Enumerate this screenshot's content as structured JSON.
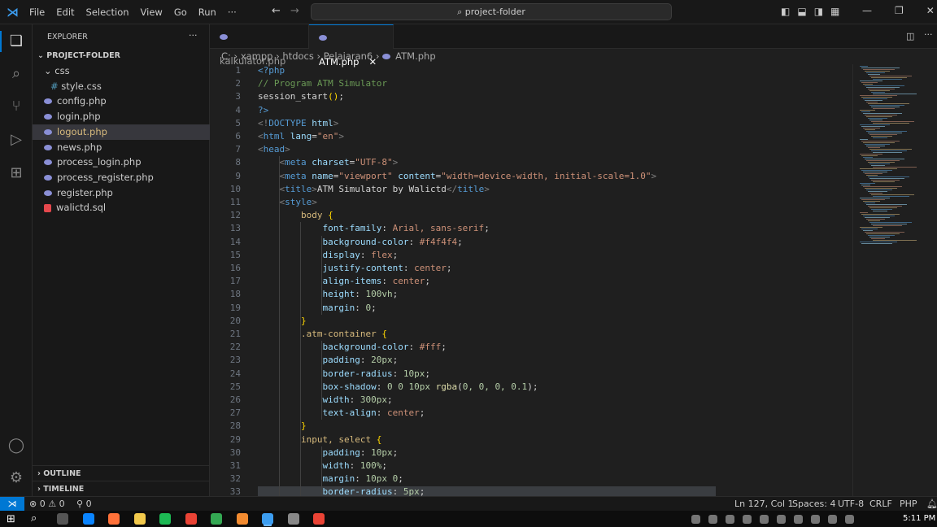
{
  "menu": [
    "File",
    "Edit",
    "Selection",
    "View",
    "Go",
    "Run",
    "···"
  ],
  "search": "project-folder",
  "explorer": {
    "title": "EXPLORER",
    "more": "···",
    "folder": "PROJECT-FOLDER",
    "items": [
      {
        "label": "css",
        "type": "folder",
        "depth": 1
      },
      {
        "label": "style.css",
        "type": "css",
        "depth": 2
      },
      {
        "label": "config.php",
        "type": "php",
        "depth": 1
      },
      {
        "label": "login.php",
        "type": "php",
        "depth": 1
      },
      {
        "label": "logout.php",
        "type": "php",
        "depth": 1,
        "selected": true
      },
      {
        "label": "news.php",
        "type": "php",
        "depth": 1
      },
      {
        "label": "process_login.php",
        "type": "php",
        "depth": 1
      },
      {
        "label": "process_register.php",
        "type": "php",
        "depth": 1
      },
      {
        "label": "register.php",
        "type": "php",
        "depth": 1
      },
      {
        "label": "walictd.sql",
        "type": "sql",
        "depth": 1
      }
    ],
    "outline": "OUTLINE",
    "timeline": "TIMELINE"
  },
  "tabs": [
    {
      "label": "kalkulator.php",
      "active": false
    },
    {
      "label": "ATM.php",
      "active": true
    }
  ],
  "breadcrumb": [
    "C:",
    "xampp",
    "htdocs",
    "Pelajaran6",
    "ATM.php"
  ],
  "code": [
    [
      [
        "t",
        "<?php"
      ]
    ],
    [
      [
        "c",
        "// Program ATM Simulator"
      ]
    ],
    [
      [
        "d",
        "session_start"
      ],
      [
        "p",
        "()"
      ],
      [
        "d",
        ";"
      ]
    ],
    [
      [
        "t",
        "?>"
      ]
    ],
    [
      [
        "b",
        "<!"
      ],
      [
        "t",
        "DOCTYPE "
      ],
      [
        "a",
        "html"
      ],
      [
        "b",
        ">"
      ]
    ],
    [
      [
        "b",
        "<"
      ],
      [
        "t",
        "html "
      ],
      [
        "a",
        "lang"
      ],
      [
        "d",
        "="
      ],
      [
        "s",
        "\"en\""
      ],
      [
        "b",
        ">"
      ]
    ],
    [
      [
        "b",
        "<"
      ],
      [
        "t",
        "head"
      ],
      [
        "b",
        ">"
      ]
    ],
    [
      [
        "d",
        "    "
      ],
      [
        "b",
        "<"
      ],
      [
        "t",
        "meta "
      ],
      [
        "a",
        "charset"
      ],
      [
        "d",
        "="
      ],
      [
        "s",
        "\"UTF-8\""
      ],
      [
        "b",
        ">"
      ]
    ],
    [
      [
        "d",
        "    "
      ],
      [
        "b",
        "<"
      ],
      [
        "t",
        "meta "
      ],
      [
        "a",
        "name"
      ],
      [
        "d",
        "="
      ],
      [
        "s",
        "\"viewport\" "
      ],
      [
        "a",
        "content"
      ],
      [
        "d",
        "="
      ],
      [
        "s",
        "\"width=device-width, initial-scale=1.0\""
      ],
      [
        "b",
        ">"
      ]
    ],
    [
      [
        "d",
        "    "
      ],
      [
        "b",
        "<"
      ],
      [
        "t",
        "title"
      ],
      [
        "b",
        ">"
      ],
      [
        "d",
        "ATM Simulator by Walictd"
      ],
      [
        "b",
        "</"
      ],
      [
        "t",
        "title"
      ],
      [
        "b",
        ">"
      ]
    ],
    [
      [
        "d",
        "    "
      ],
      [
        "b",
        "<"
      ],
      [
        "t",
        "style"
      ],
      [
        "b",
        ">"
      ]
    ],
    [
      [
        "d",
        "        "
      ],
      [
        "sel",
        "body "
      ],
      [
        "p",
        "{"
      ]
    ],
    [
      [
        "d",
        "            "
      ],
      [
        "a",
        "font-family"
      ],
      [
        "d",
        ": "
      ],
      [
        "v",
        "Arial, sans-serif"
      ],
      [
        "d",
        ";"
      ]
    ],
    [
      [
        "d",
        "            "
      ],
      [
        "a",
        "background-color"
      ],
      [
        "d",
        ": "
      ],
      [
        "v",
        "#f4f4f4"
      ],
      [
        "d",
        ";"
      ]
    ],
    [
      [
        "d",
        "            "
      ],
      [
        "a",
        "display"
      ],
      [
        "d",
        ": "
      ],
      [
        "v",
        "flex"
      ],
      [
        "d",
        ";"
      ]
    ],
    [
      [
        "d",
        "            "
      ],
      [
        "a",
        "justify-content"
      ],
      [
        "d",
        ": "
      ],
      [
        "v",
        "center"
      ],
      [
        "d",
        ";"
      ]
    ],
    [
      [
        "d",
        "            "
      ],
      [
        "a",
        "align-items"
      ],
      [
        "d",
        ": "
      ],
      [
        "v",
        "center"
      ],
      [
        "d",
        ";"
      ]
    ],
    [
      [
        "d",
        "            "
      ],
      [
        "a",
        "height"
      ],
      [
        "d",
        ": "
      ],
      [
        "n",
        "100vh"
      ],
      [
        "d",
        ";"
      ]
    ],
    [
      [
        "d",
        "            "
      ],
      [
        "a",
        "margin"
      ],
      [
        "d",
        ": "
      ],
      [
        "n",
        "0"
      ],
      [
        "d",
        ";"
      ]
    ],
    [
      [
        "d",
        "        "
      ],
      [
        "p",
        "}"
      ]
    ],
    [
      [
        "d",
        "        "
      ],
      [
        "sel",
        ".atm-container "
      ],
      [
        "p",
        "{"
      ]
    ],
    [
      [
        "d",
        "            "
      ],
      [
        "a",
        "background-color"
      ],
      [
        "d",
        ": "
      ],
      [
        "v",
        "#fff"
      ],
      [
        "d",
        ";"
      ]
    ],
    [
      [
        "d",
        "            "
      ],
      [
        "a",
        "padding"
      ],
      [
        "d",
        ": "
      ],
      [
        "n",
        "20px"
      ],
      [
        "d",
        ";"
      ]
    ],
    [
      [
        "d",
        "            "
      ],
      [
        "a",
        "border-radius"
      ],
      [
        "d",
        ": "
      ],
      [
        "n",
        "10px"
      ],
      [
        "d",
        ";"
      ]
    ],
    [
      [
        "d",
        "            "
      ],
      [
        "a",
        "box-shadow"
      ],
      [
        "d",
        ": "
      ],
      [
        "n",
        "0 0 10px "
      ],
      [
        "f",
        "rgba"
      ],
      [
        "d",
        "("
      ],
      [
        "n",
        "0, 0, 0, 0.1"
      ],
      [
        "d",
        ")"
      ],
      [
        "d",
        ";"
      ]
    ],
    [
      [
        "d",
        "            "
      ],
      [
        "a",
        "width"
      ],
      [
        "d",
        ": "
      ],
      [
        "n",
        "300px"
      ],
      [
        "d",
        ";"
      ]
    ],
    [
      [
        "d",
        "            "
      ],
      [
        "a",
        "text-align"
      ],
      [
        "d",
        ": "
      ],
      [
        "v",
        "center"
      ],
      [
        "d",
        ";"
      ]
    ],
    [
      [
        "d",
        "        "
      ],
      [
        "p",
        "}"
      ]
    ],
    [
      [
        "d",
        "        "
      ],
      [
        "sel",
        "input, select "
      ],
      [
        "p",
        "{"
      ]
    ],
    [
      [
        "d",
        "            "
      ],
      [
        "a",
        "padding"
      ],
      [
        "d",
        ": "
      ],
      [
        "n",
        "10px"
      ],
      [
        "d",
        ";"
      ]
    ],
    [
      [
        "d",
        "            "
      ],
      [
        "a",
        "width"
      ],
      [
        "d",
        ": "
      ],
      [
        "n",
        "100%"
      ],
      [
        "d",
        ";"
      ]
    ],
    [
      [
        "d",
        "            "
      ],
      [
        "a",
        "margin"
      ],
      [
        "d",
        ": "
      ],
      [
        "n",
        "10px 0"
      ],
      [
        "d",
        ";"
      ]
    ],
    [
      [
        "d",
        "            "
      ],
      [
        "a",
        "border-radius"
      ],
      [
        "d",
        ": "
      ],
      [
        "n",
        "5px"
      ],
      [
        "d",
        ";"
      ]
    ]
  ],
  "status": {
    "errors": "0",
    "warnings": "0",
    "ports": "0",
    "position": "Ln 127, Col 1",
    "spaces": "Spaces: 4",
    "encoding": "UTF-8",
    "eol": "CRLF",
    "language": "PHP"
  },
  "taskbar": {
    "time": "5:11 PM"
  },
  "colors": {
    "accent": "#0078d4",
    "background": "#1f1f1f"
  }
}
